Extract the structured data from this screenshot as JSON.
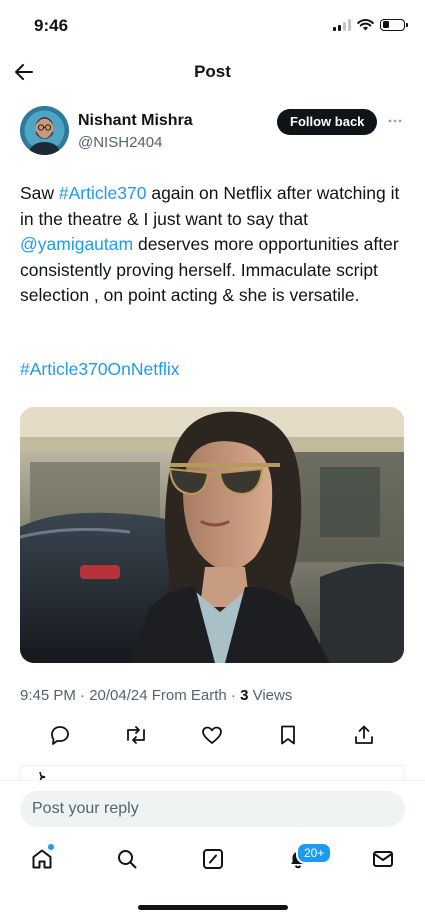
{
  "status_bar": {
    "time": "9:46"
  },
  "header": {
    "title": "Post",
    "back_icon": "arrow-left-icon"
  },
  "author": {
    "name": "Nishant Mishra",
    "handle": "@NISH2404",
    "follow_label": "Follow back",
    "more_icon": "more-horizontal-icon"
  },
  "tweet": {
    "text_1": "Saw ",
    "hashtag_1": "#Article370",
    "text_2": " again on Netflix after watching it in the theatre & I just want to say that ",
    "mention": "@yamigautam",
    "text_3": " deserves more opportunities after  consistently proving herself. Immaculate script selection , on point acting & she is versatile.",
    "hashtag_2": "#Article370OnNetflix"
  },
  "meta": {
    "timestamp": "9:45 PM · 20/04/24 From Earth · ",
    "views_count": "3",
    "views_label": " Views"
  },
  "actions": {
    "reply_icon": "reply-icon",
    "repost_icon": "repost-icon",
    "like_icon": "heart-icon",
    "bookmark_icon": "bookmark-icon",
    "share_icon": "share-icon"
  },
  "reply_bar": {
    "placeholder": "Post your reply"
  },
  "tab_bar": {
    "notifications_badge": "20+",
    "items": [
      "home-icon",
      "search-icon",
      "compose-icon",
      "notifications-icon",
      "messages-icon"
    ]
  },
  "colors": {
    "accent": "#1d9bf0",
    "text": "#0f1419",
    "secondary_text": "#536471"
  }
}
